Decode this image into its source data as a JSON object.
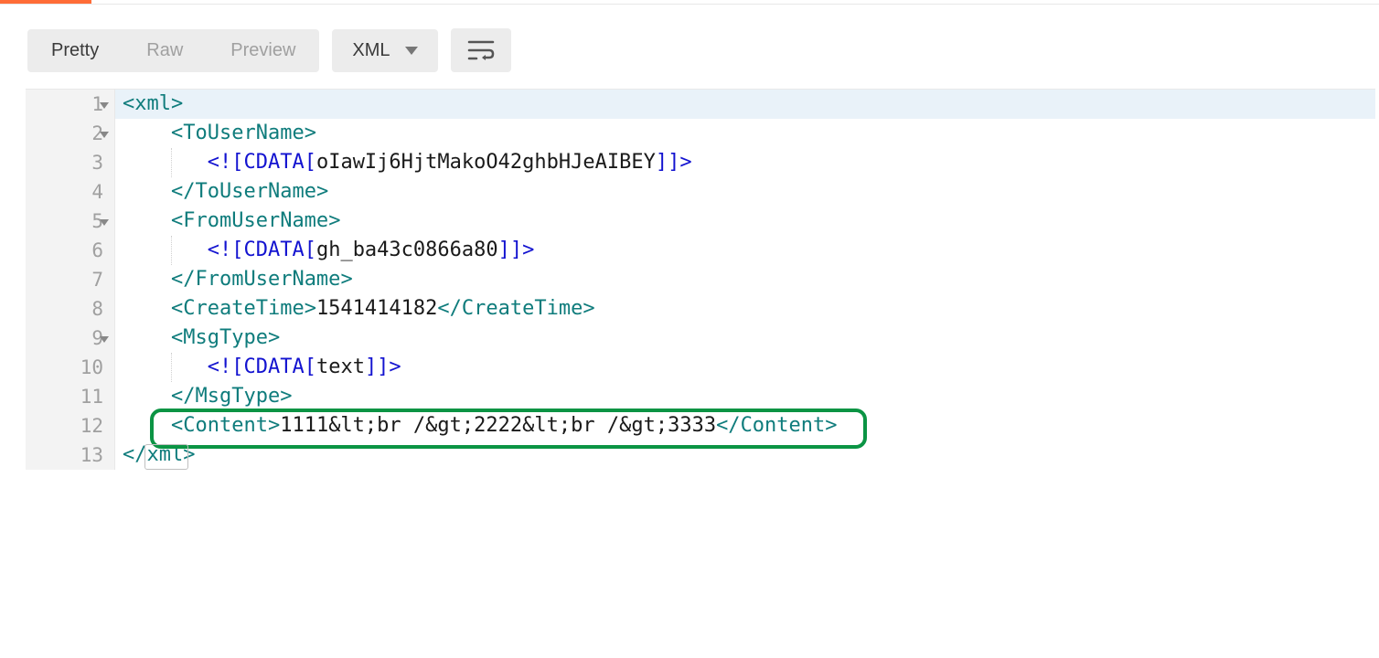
{
  "toolbar": {
    "tabs": {
      "pretty": "Pretty",
      "raw": "Raw",
      "preview": "Preview"
    },
    "format_selector": "XML"
  },
  "code": {
    "lines": [
      {
        "num": "1",
        "foldable": true
      },
      {
        "num": "2",
        "foldable": true
      },
      {
        "num": "3",
        "foldable": false
      },
      {
        "num": "4",
        "foldable": false
      },
      {
        "num": "5",
        "foldable": true
      },
      {
        "num": "6",
        "foldable": false
      },
      {
        "num": "7",
        "foldable": false
      },
      {
        "num": "8",
        "foldable": false
      },
      {
        "num": "9",
        "foldable": true
      },
      {
        "num": "10",
        "foldable": false
      },
      {
        "num": "11",
        "foldable": false
      },
      {
        "num": "12",
        "foldable": false
      },
      {
        "num": "13",
        "foldable": false
      }
    ],
    "xml_root": "xml",
    "to_user_name_tag": "ToUserName",
    "to_user_name_value": "oIawIj6HjtMakoO42ghbHJeAIBEY",
    "from_user_name_tag": "FromUserName",
    "from_user_name_value": "gh_ba43c0866a80",
    "create_time_tag": "CreateTime",
    "create_time_value": "1541414182",
    "msg_type_tag": "MsgType",
    "msg_type_value": "text",
    "content_tag": "Content",
    "content_value_1": "1111",
    "content_entity_lt": "&lt;",
    "content_br": "br /",
    "content_entity_gt": "&gt;",
    "content_value_2": "2222",
    "content_value_3": "3333",
    "cdata_open": "<![",
    "cdata_kw": "CDATA[",
    "cdata_close": "]]>"
  }
}
